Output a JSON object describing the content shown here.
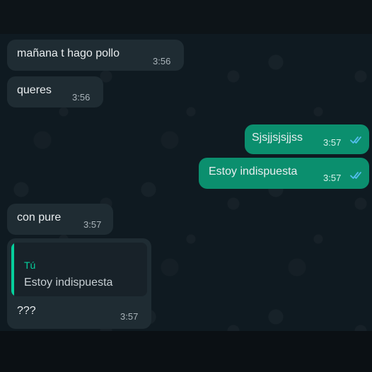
{
  "messages": [
    {
      "text": "mañana t hago pollo",
      "time": "3:56"
    },
    {
      "text": "queres",
      "time": "3:56"
    },
    {
      "text": "Sjsjjsjsjjss",
      "time": "3:57"
    },
    {
      "text": "Estoy indispuesta",
      "time": "3:57"
    },
    {
      "text": "con pure",
      "time": "3:57"
    },
    {
      "text": "???",
      "time": "3:57",
      "reply": {
        "author": "Tú",
        "text": "Estoy indispuesta"
      }
    }
  ],
  "colors": {
    "incoming_bubble": "#1f2c33",
    "outgoing_bubble": "#0b8f6e",
    "read_ticks": "#53bdeb",
    "reply_accent": "#06cf9c",
    "chat_background": "#0f1a21"
  },
  "icons": {
    "read_status": "double-check-icon"
  }
}
